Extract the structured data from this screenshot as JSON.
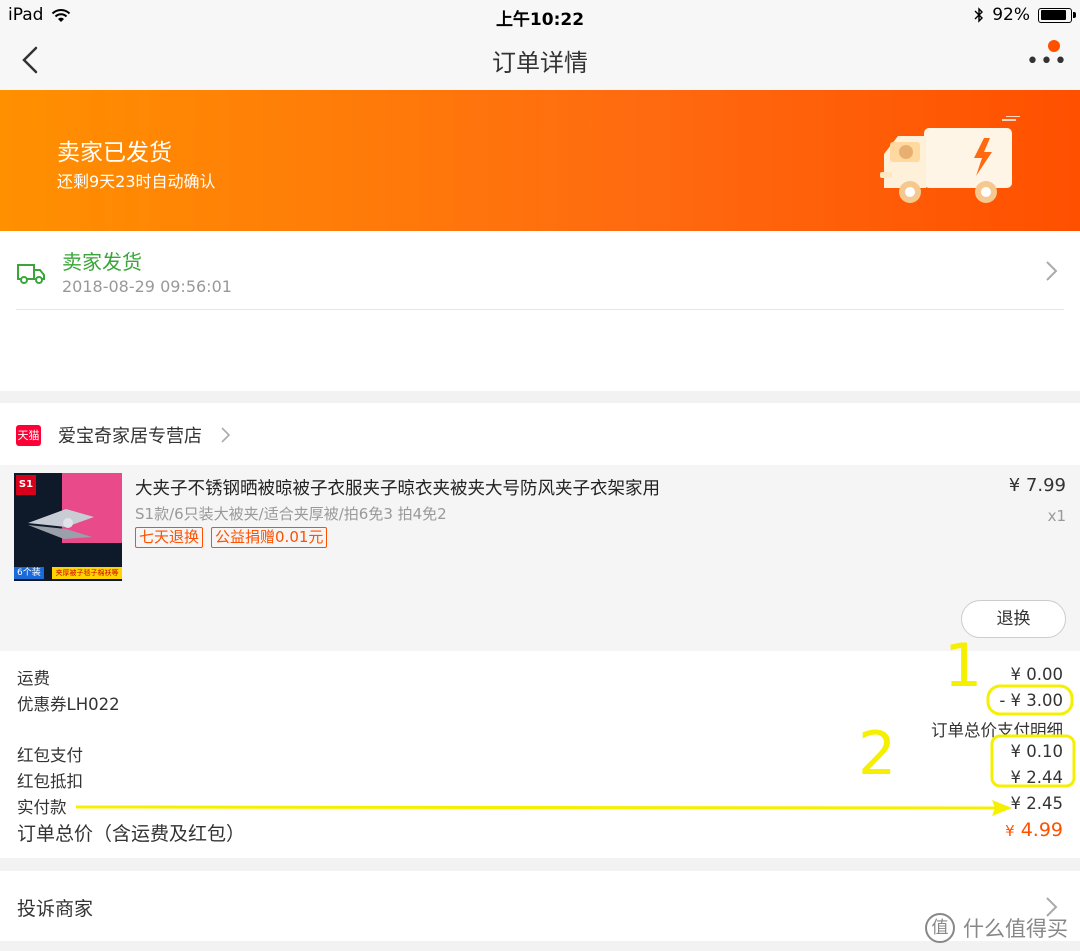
{
  "status_bar": {
    "device": "iPad",
    "time": "上午10:22",
    "battery_text": "92%",
    "battery_level": 0.92
  },
  "nav": {
    "title": "订单详情"
  },
  "banner": {
    "title": "卖家已发货",
    "subtitle": "还剩9天23时自动确认"
  },
  "shipping": {
    "status": "卖家发货",
    "time": "2018-08-29 09:56:01"
  },
  "shop": {
    "badge": "天猫",
    "name": "爱宝奇家居专营店"
  },
  "item": {
    "thumb_badge": "S1",
    "thumb_count": "6个装",
    "thumb_banner": "夹厚被子毯子棉袄等",
    "title": "大夹子不锈钢晒被晾被子衣服夹子晾衣夹被夹大号防风夹子衣架家用",
    "spec": "S1款/6只装大被夹/适合夹厚被/拍6免3 拍4免2",
    "tags": [
      "七天退换",
      "公益捐赠0.01元"
    ],
    "price": "¥ 7.99",
    "qty": "x1",
    "refund_label": "退换"
  },
  "fees": {
    "shipping_label": "运费",
    "shipping_value": "¥ 0.00",
    "coupon_label": "优惠券LH022",
    "coupon_value": "- ¥ 3.00",
    "detail_heading": "订单总价支付明细",
    "redpacket_pay_label": "红包支付",
    "redpacket_pay_value": "¥ 0.10",
    "redpacket_deduct_label": "红包抵扣",
    "redpacket_deduct_value": "¥ 2.44",
    "actual_label": "实付款",
    "actual_value": "¥ 2.45",
    "total_label": "订单总价（含运费及红包）",
    "total_currency": "¥",
    "total_value": "4.99"
  },
  "complain": {
    "label": "投诉商家"
  },
  "annotations": {
    "num1": "1",
    "num2": "2",
    "color": "#f5f000"
  },
  "watermark": {
    "icon_text": "值",
    "text": "什么值得买"
  },
  "colors": {
    "accent": "#ff5000",
    "banner_start": "#ff9000",
    "green": "#3aa63a"
  }
}
